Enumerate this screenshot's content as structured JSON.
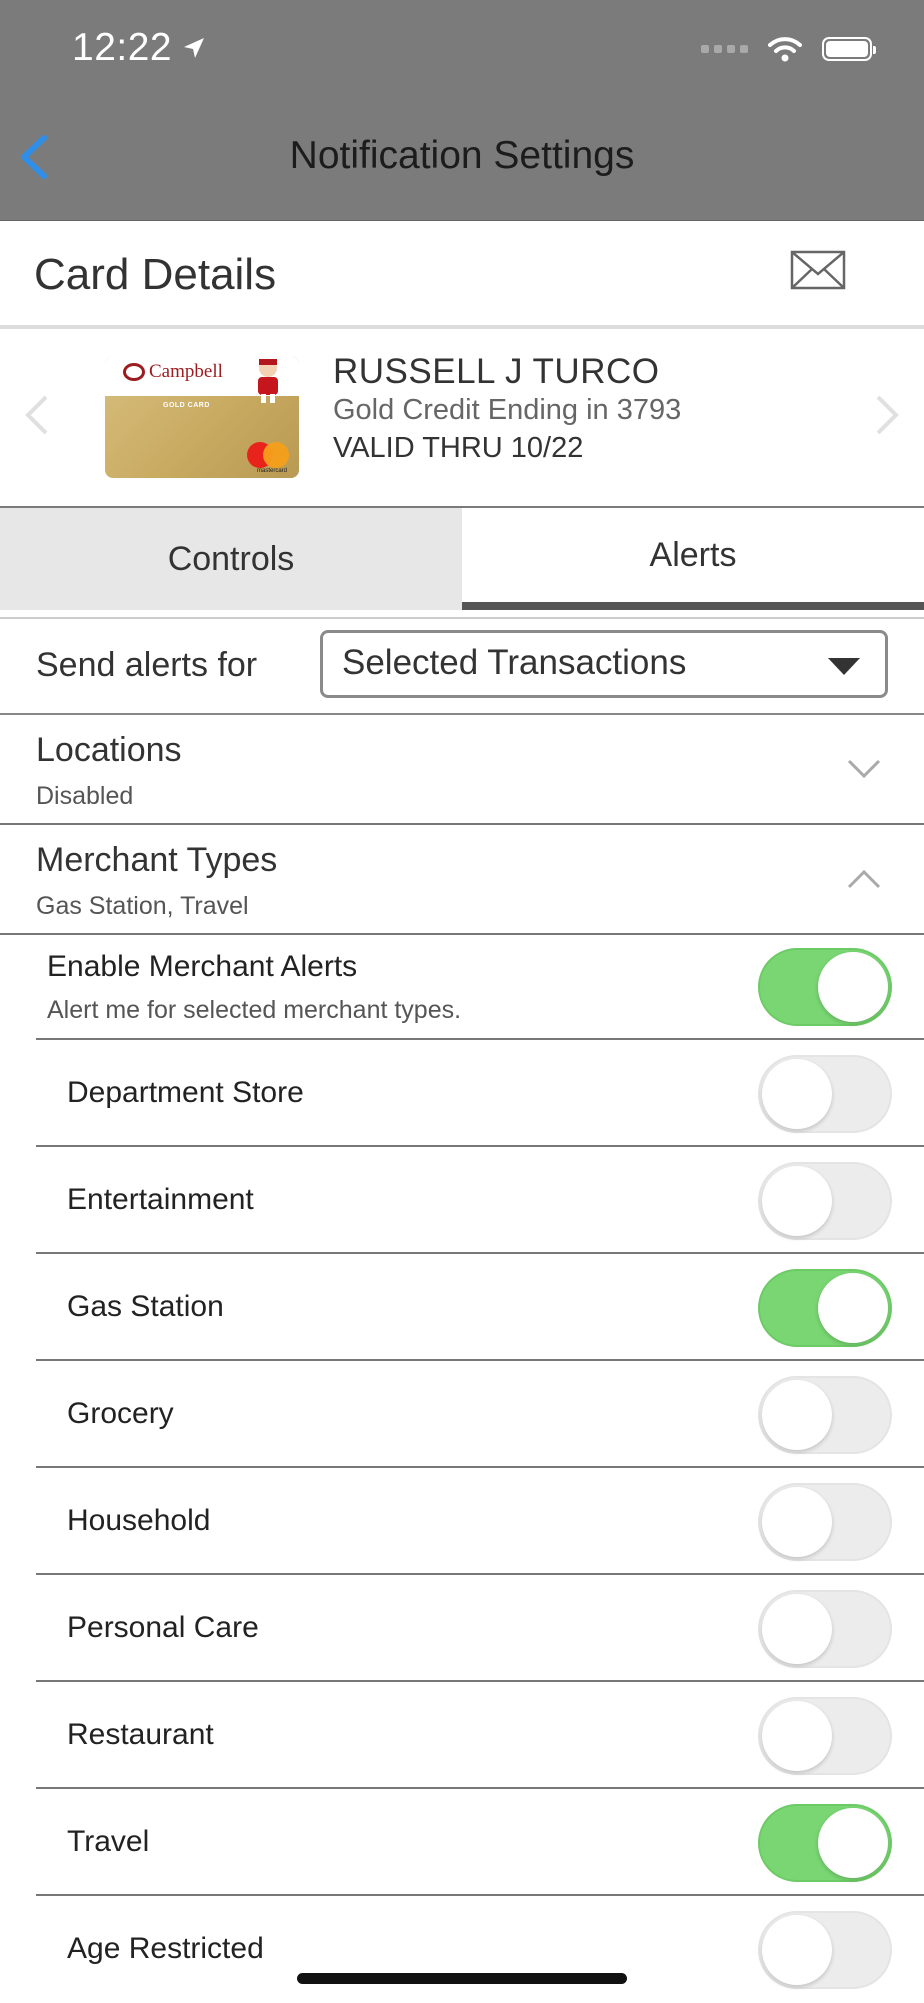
{
  "status_bar": {
    "time": "12:22"
  },
  "nav": {
    "title": "Notification Settings"
  },
  "card_details": {
    "title": "Card Details",
    "card": {
      "issuer_logo": "Campbell",
      "card_label": "GOLD CARD",
      "network": "mastercard",
      "holder_name": "RUSSELL J TURCO",
      "description": "Gold Credit Ending in 3793",
      "valid_thru": "VALID THRU 10/22"
    }
  },
  "tabs": [
    {
      "label": "Controls",
      "selected": false
    },
    {
      "label": "Alerts",
      "selected": true
    }
  ],
  "send_alerts": {
    "label": "Send alerts for",
    "value": "Selected Transactions"
  },
  "sections": {
    "locations": {
      "title": "Locations",
      "subtitle": "Disabled",
      "expanded": false
    },
    "merchant_types": {
      "title": "Merchant Types",
      "subtitle": "Gas Station, Travel",
      "expanded": true
    }
  },
  "merchant_alerts": {
    "title": "Enable Merchant Alerts",
    "subtitle": "Alert me for selected merchant types.",
    "enabled": true
  },
  "merchant_types": [
    {
      "label": "Department Store",
      "enabled": false
    },
    {
      "label": "Entertainment",
      "enabled": false
    },
    {
      "label": "Gas Station",
      "enabled": true
    },
    {
      "label": "Grocery",
      "enabled": false
    },
    {
      "label": "Household",
      "enabled": false
    },
    {
      "label": "Personal Care",
      "enabled": false
    },
    {
      "label": "Restaurant",
      "enabled": false
    },
    {
      "label": "Travel",
      "enabled": true
    },
    {
      "label": "Age Restricted",
      "enabled": false
    }
  ],
  "colors": {
    "header": "#7b7b7b",
    "toggle_on": "#79d672",
    "back_arrow": "#2f8ee8"
  }
}
